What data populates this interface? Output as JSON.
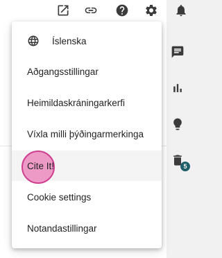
{
  "menu": {
    "items": [
      {
        "label": "Íslenska",
        "icon": "globe-icon"
      },
      {
        "label": "Aðgangsstillingar"
      },
      {
        "label": "Heimildaskráningarkerfi"
      },
      {
        "label": "Víxla milli þýðingarmerkinga"
      },
      {
        "label": "Cite It!",
        "highlighted": true
      },
      {
        "label": "Cookie settings"
      },
      {
        "label": "Notandastillingar"
      }
    ]
  },
  "toolbar": {
    "icons": [
      "open-in-new-icon",
      "link-icon",
      "help-icon",
      "settings-icon",
      "notifications-icon"
    ]
  },
  "side_panel": {
    "icons": [
      "comment-icon",
      "bar-chart-icon",
      "lightbulb-icon",
      "delete-icon"
    ],
    "badge_count": "5"
  },
  "colors": {
    "icon": "#3b3b3b",
    "badge": "#1f5f69",
    "pointer": "#e862aa",
    "highlight": "#f4f4f4"
  }
}
